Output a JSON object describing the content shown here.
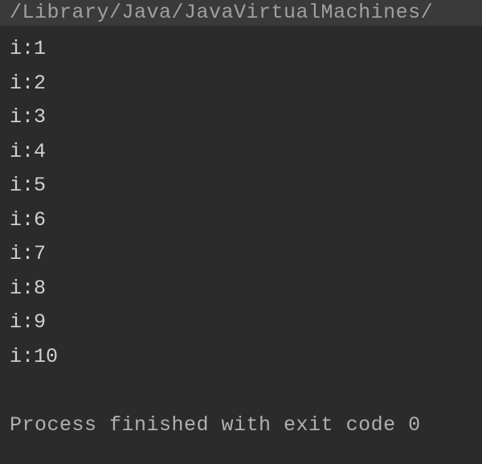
{
  "header": {
    "path": "/Library/Java/JavaVirtualMachines/"
  },
  "output": {
    "lines": [
      "i:1",
      "i:2",
      "i:3",
      "i:4",
      "i:5",
      "i:6",
      "i:7",
      "i:8",
      "i:9",
      "i:10"
    ]
  },
  "status": {
    "message": "Process finished with exit code 0"
  }
}
